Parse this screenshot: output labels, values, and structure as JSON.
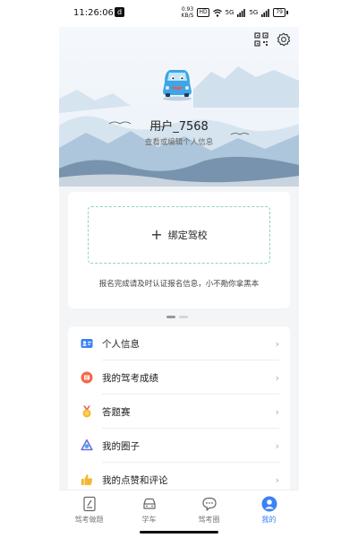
{
  "status_bar": {
    "time": "11:26:06",
    "app_badge": "d",
    "net_rate_value": "0.93",
    "net_rate_unit": "KB/S",
    "hd_label": "HD",
    "signal_1": "5G",
    "signal_2": "5G",
    "battery": "79"
  },
  "profile": {
    "username": "用户_7568",
    "edit_hint": "查看或编辑个人信息"
  },
  "bind_card": {
    "plus": "+",
    "label": "绑定驾校",
    "hint": "报名完成请及时认证报名信息，小不勛你拿黑本"
  },
  "menu": {
    "items": [
      {
        "label": "个人信息",
        "icon": "id-card-icon"
      },
      {
        "label": "我的驾考成绩",
        "icon": "score-icon"
      },
      {
        "label": "答题赛",
        "icon": "medal-icon"
      },
      {
        "label": "我的圈子",
        "icon": "circle-icon"
      },
      {
        "label": "我的点赞和评论",
        "icon": "thumbs-up-icon"
      }
    ],
    "chevron": "›"
  },
  "tabs": [
    {
      "label": "驾考做题",
      "icon": "exam-icon",
      "active": false
    },
    {
      "label": "学车",
      "icon": "car-icon",
      "active": false
    },
    {
      "label": "驾考圈",
      "icon": "chat-icon",
      "active": false
    },
    {
      "label": "我的",
      "icon": "user-icon",
      "active": true
    }
  ],
  "colors": {
    "accent": "#3b82f6",
    "dashed_border": "#8fd3c8",
    "background": "#f4f5f7"
  }
}
